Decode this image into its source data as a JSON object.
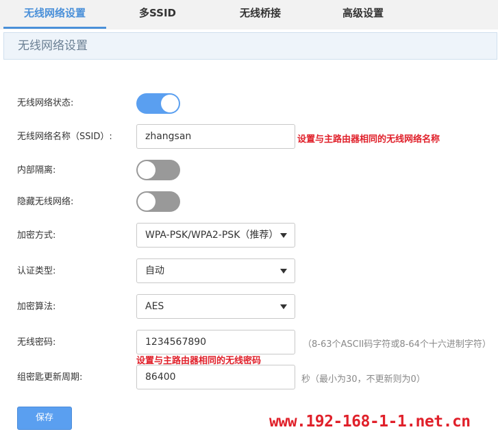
{
  "tabs": [
    {
      "label": "无线网络设置",
      "active": true
    },
    {
      "label": "多SSID",
      "active": false
    },
    {
      "label": "无线桥接",
      "active": false
    },
    {
      "label": "高级设置",
      "active": false
    }
  ],
  "section": {
    "title": "无线网络设置"
  },
  "form": {
    "wireless_status": {
      "label": "无线网络状态:",
      "on": true
    },
    "ssid": {
      "label": "无线网络名称（SSID）:",
      "value": "zhangsan",
      "note": "设置与主路由器相同的无线网络名称"
    },
    "isolation": {
      "label": "内部隔离:",
      "on": false
    },
    "hide_ssid": {
      "label": "隐藏无线网络:",
      "on": false
    },
    "encryption_mode": {
      "label": "加密方式:",
      "value": "WPA-PSK/WPA2-PSK（推荐）"
    },
    "auth_type": {
      "label": "认证类型:",
      "value": "自动"
    },
    "cipher": {
      "label": "加密算法:",
      "value": "AES"
    },
    "password": {
      "label": "无线密码:",
      "value": "1234567890",
      "hint": "（8-63个ASCII码字符或8-64个十六进制字符）",
      "note": "设置与主路由器相同的无线密码"
    },
    "rekey": {
      "label": "组密匙更新周期:",
      "value": "86400",
      "hint": "秒（最小为30，不更新则为0）"
    }
  },
  "save_label": "保存",
  "watermark": "www.192-168-1-1.net.cn",
  "colors": {
    "accent": "#4a90d9",
    "toggle_on": "#5a9ff0",
    "toggle_off": "#999999",
    "note_red": "#e0202a"
  }
}
